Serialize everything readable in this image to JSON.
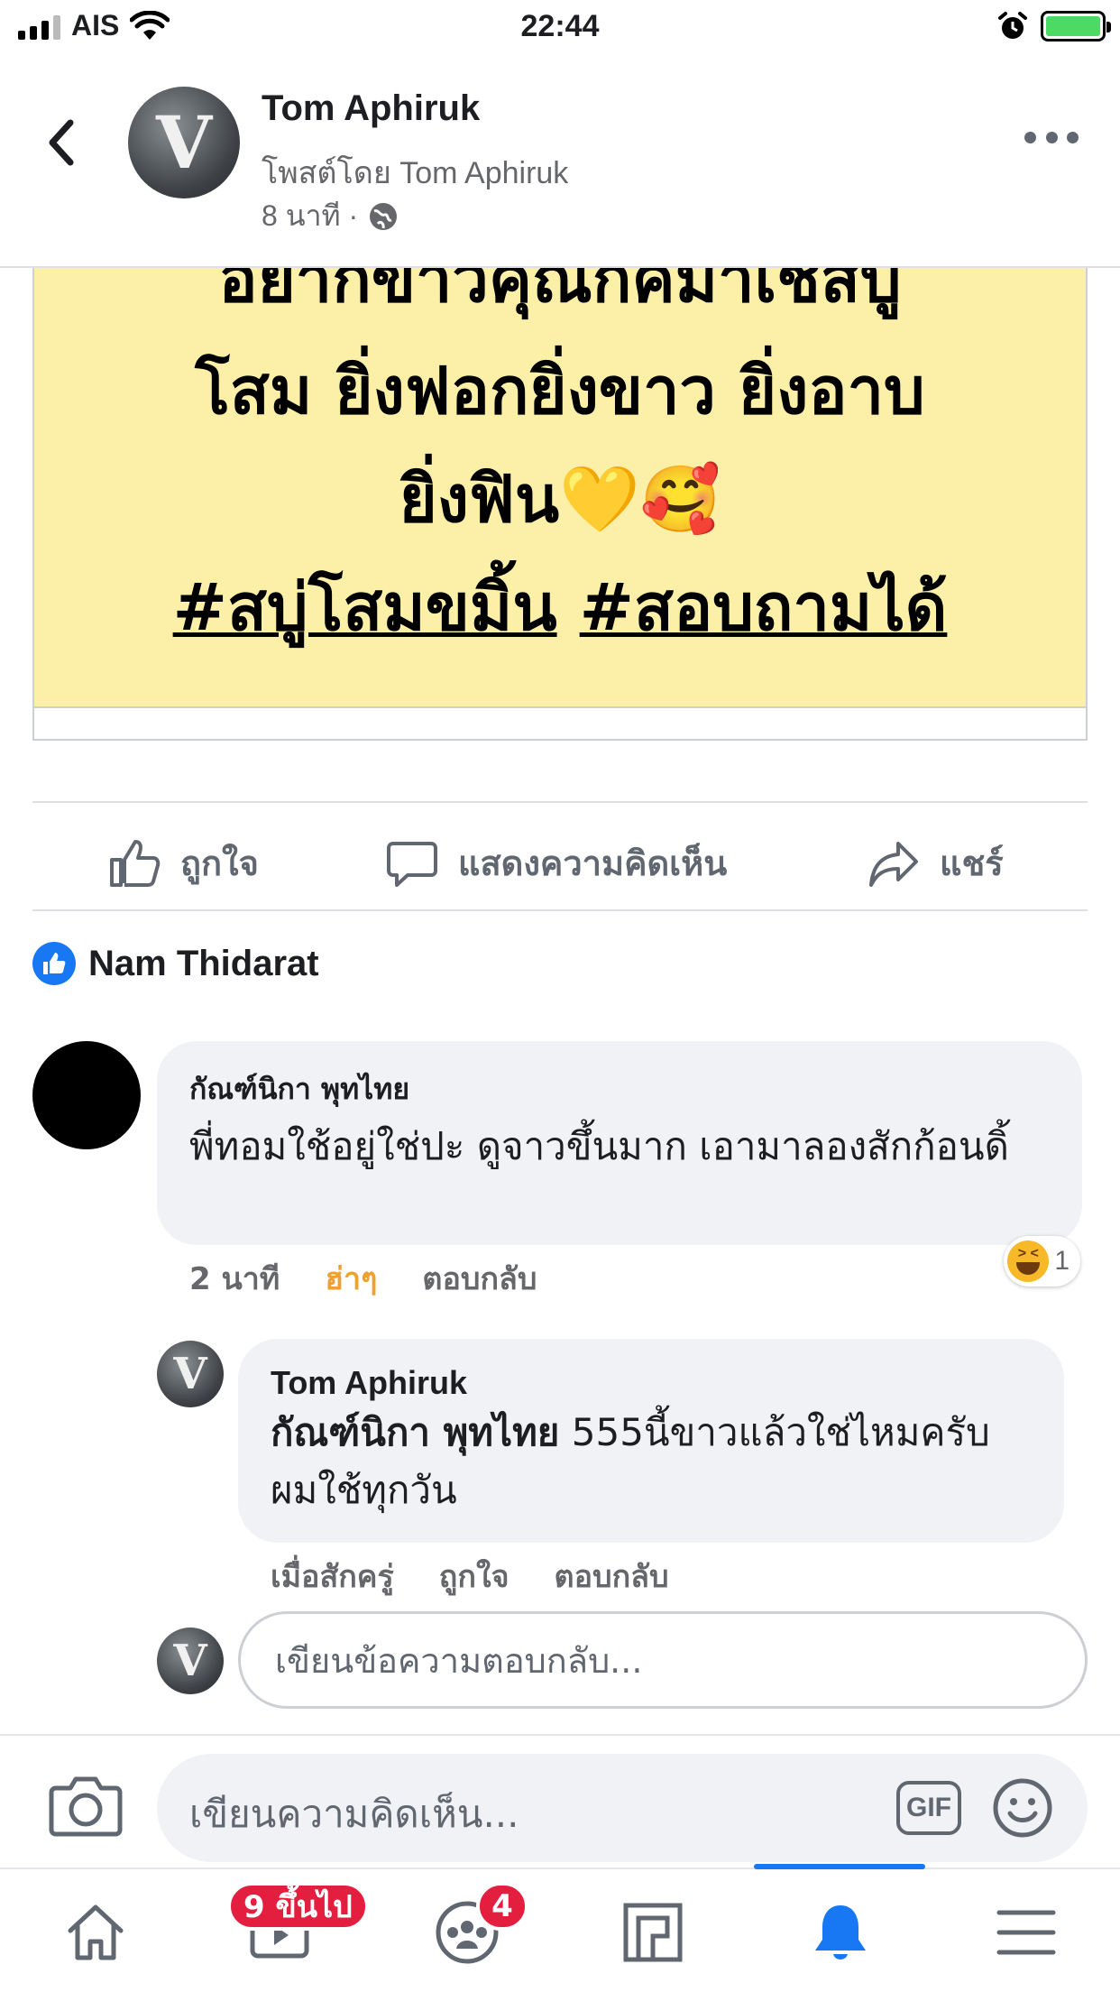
{
  "status_bar": {
    "carrier": "AIS",
    "time": "22:44"
  },
  "header": {
    "poster_name": "Tom Aphiruk",
    "posted_by": "โพสต์โดย Tom Aphiruk",
    "time_ago": "8 นาที ·"
  },
  "post": {
    "line_0": "อยากขาวคุณกคิมาเช้สบู่",
    "line_1": "โสม ยิ่งฟอกยิ่งขาว ยิ่งอาบ",
    "line_2": "ยิ่งฟิน💛🥰",
    "hashtag_1": "#สบู่โสมขมิ้น",
    "hashtag_2": "#สอบถามได้",
    "background_color": "#fcf0a8"
  },
  "actions": {
    "like": "ถูกใจ",
    "comment": "แสดงความคิดเห็น",
    "share": "แชร์"
  },
  "liked_by": "Nam Thidarat",
  "comments": [
    {
      "name": "กัณฑ์นิกา พุทไทย",
      "text": "พี่ทอมใช้อยู่ใช่ปะ ดูจาวขึ้นมาก เอามาลองสักก้อนดิ้",
      "time": "2 นาที",
      "reaction_label": "ฮ่าๆ",
      "reply_label": "ตอบกลับ",
      "reaction_count": "1"
    },
    {
      "name": "Tom Aphiruk",
      "mention": "กัณฑ์นิกา พุทไทย",
      "text": " 555นี้ขาวแล้วใช่ไหมครับผมใช้ทุกวัน",
      "time": "เมื่อสักครู่",
      "like_label": "ถูกใจ",
      "reply_label": "ตอบกลับ"
    }
  ],
  "reply_input": {
    "placeholder": "เขียนข้อความตอบกลับ..."
  },
  "comment_bar": {
    "placeholder": "เขียนความคิดเห็น...",
    "gif_label": "GIF"
  },
  "tab_bar": {
    "video_badge": "9 ขึ้นไป",
    "groups_badge": "4",
    "active_tab": "notifications"
  },
  "colors": {
    "accent": "#1877f2",
    "badge": "#e41e3f",
    "haha_link": "#f0a030"
  }
}
